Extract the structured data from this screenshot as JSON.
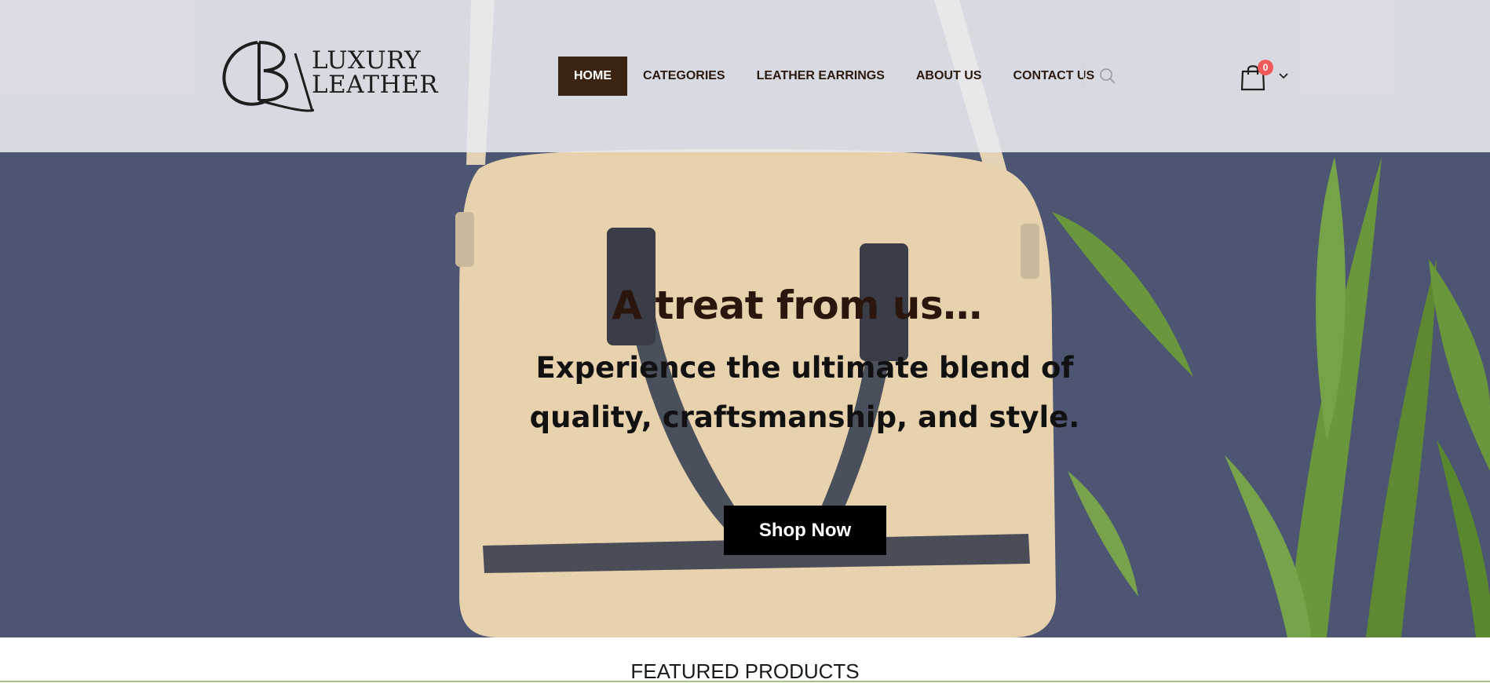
{
  "brand": {
    "logo_line1": "LUXURY",
    "logo_line2": "LEATHER"
  },
  "nav": {
    "items": [
      {
        "label": "HOME",
        "active": true
      },
      {
        "label": "CATEGORIES",
        "active": false
      },
      {
        "label": "LEATHER EARRINGS",
        "active": false
      },
      {
        "label": "ABOUT US",
        "active": false
      },
      {
        "label": "CONTACT US",
        "active": false
      }
    ],
    "active_color": "#3a2411"
  },
  "header": {
    "search_icon": "search-icon",
    "cart_icon": "shopping-bag-icon",
    "cart_count": "0",
    "cart_badge_color": "#f05a5a"
  },
  "hero": {
    "title": "A treat from us…",
    "subtitle": "Experience the ultimate blend of quality, craftsmanship, and style.",
    "cta_label": "Shop Now"
  },
  "featured": {
    "title": "FEATURED PRODUCTS"
  }
}
